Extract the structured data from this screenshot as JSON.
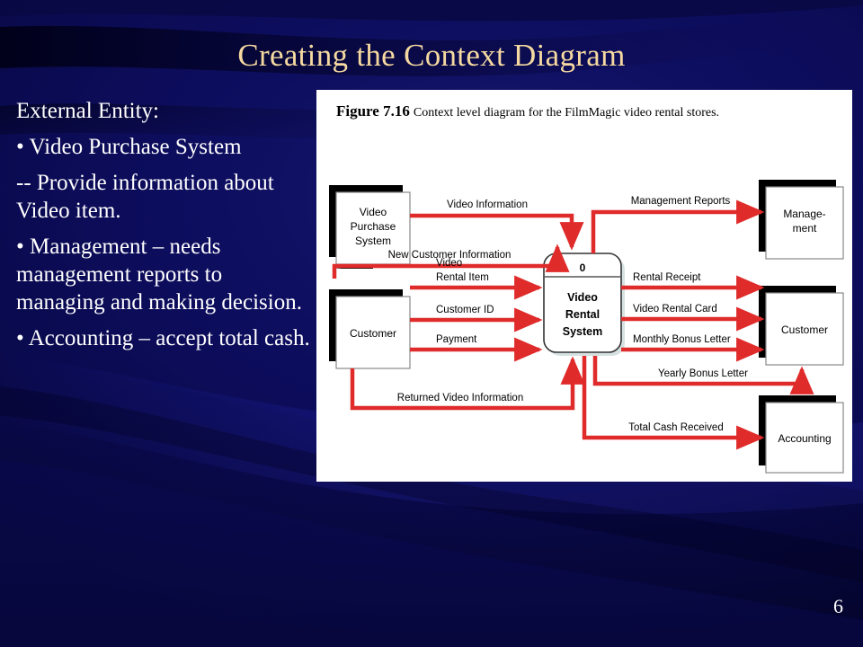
{
  "slide": {
    "title": "Creating the Context Diagram",
    "number": "6",
    "background_color": "#0d0d5e",
    "title_color": "#f5d9a0",
    "body_text_color": "#ffffff"
  },
  "bullets": [
    {
      "text": "External Entity:"
    },
    {
      "text": "• Video Purchase System"
    },
    {
      "text": "-- Provide information about Video item."
    },
    {
      "text": "• Management – needs management reports to managing and making decision."
    },
    {
      "text": "• Accounting – accept total cash."
    }
  ],
  "figure": {
    "number_label": "Figure 7.16",
    "caption": "Context level diagram for the FilmMagic video rental stores.",
    "accent_color": "#e02b2b",
    "entities": [
      {
        "id": "video-purchase-system",
        "label_lines": [
          "Video",
          "Purchase",
          "System"
        ]
      },
      {
        "id": "customer-left",
        "label_lines": [
          "Customer"
        ]
      },
      {
        "id": "management",
        "label_lines": [
          "Manage-",
          "ment"
        ]
      },
      {
        "id": "customer-right",
        "label_lines": [
          "Customer"
        ]
      },
      {
        "id": "accounting",
        "label_lines": [
          "Accounting"
        ]
      }
    ],
    "process": {
      "id": "video-rental-system",
      "number": "0",
      "label_lines": [
        "Video",
        "Rental",
        "System"
      ]
    },
    "flows": [
      {
        "id": "video-information",
        "label": "Video Information"
      },
      {
        "id": "new-customer-information",
        "label": "New Customer Information"
      },
      {
        "id": "management-reports",
        "label": "Management Reports"
      },
      {
        "id": "video-rental-item",
        "label_lines": [
          "Video",
          "Rental Item"
        ]
      },
      {
        "id": "customer-id",
        "label": "Customer ID"
      },
      {
        "id": "payment",
        "label": "Payment"
      },
      {
        "id": "rental-receipt",
        "label": "Rental Receipt"
      },
      {
        "id": "video-rental-card",
        "label": "Video Rental Card"
      },
      {
        "id": "monthly-bonus-letter",
        "label": "Monthly Bonus Letter"
      },
      {
        "id": "yearly-bonus-letter",
        "label": "Yearly Bonus Letter"
      },
      {
        "id": "returned-video-information",
        "label": "Returned Video Information"
      },
      {
        "id": "total-cash-received",
        "label": "Total Cash Received"
      }
    ]
  }
}
